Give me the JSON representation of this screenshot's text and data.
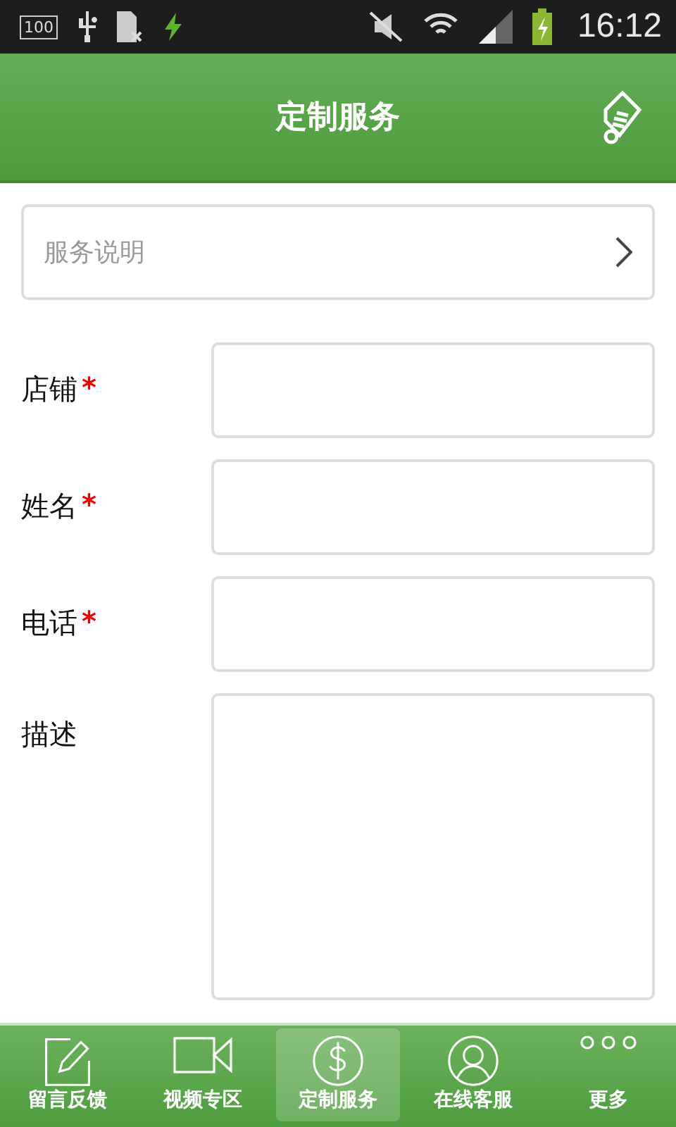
{
  "status_bar": {
    "badge": "100",
    "time": "16:12"
  },
  "header": {
    "title": "定制服务"
  },
  "info_row": {
    "label": "服务说明"
  },
  "form": {
    "fields": [
      {
        "label": "店铺",
        "required": true,
        "kind": "input"
      },
      {
        "label": "姓名",
        "required": true,
        "kind": "input"
      },
      {
        "label": "电话",
        "required": true,
        "kind": "input"
      },
      {
        "label": "描述",
        "required": false,
        "kind": "textarea"
      }
    ],
    "required_mark": "*"
  },
  "tabs": [
    {
      "label": "留言反馈",
      "kind": "edit",
      "selected": false
    },
    {
      "label": "视频专区",
      "kind": "video",
      "selected": false
    },
    {
      "label": "定制服务",
      "kind": "dollar",
      "selected": true
    },
    {
      "label": "在线客服",
      "kind": "user",
      "selected": false
    },
    {
      "label": "更多",
      "kind": "more",
      "selected": false
    }
  ]
}
